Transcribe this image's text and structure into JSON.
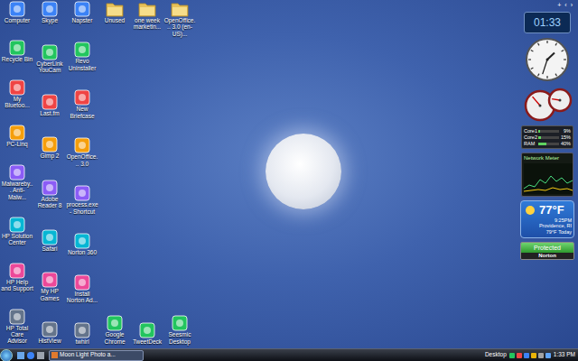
{
  "desktop": {
    "columns": [
      {
        "icons": [
          {
            "label": "Computer",
            "kind": "app"
          },
          {
            "label": "Recycle Bin",
            "kind": "app"
          },
          {
            "label": "My Bluetoo...",
            "kind": "app"
          },
          {
            "label": "PC-Linq",
            "kind": "app"
          },
          {
            "label": "Malwareby... Anti-Malw...",
            "kind": "app"
          },
          {
            "label": "HP Solution Center",
            "kind": "app"
          },
          {
            "label": "HP Help and Support",
            "kind": "app"
          },
          {
            "label": "HP Total Care Advisor",
            "kind": "app"
          }
        ]
      },
      {
        "icons": [
          {
            "label": "Skype",
            "kind": "app"
          },
          {
            "label": "CyberLink YouCam",
            "kind": "app"
          },
          {
            "label": "Last.fm",
            "kind": "app"
          },
          {
            "label": "Gimp 2",
            "kind": "app"
          },
          {
            "label": "Adobe Reader 8",
            "kind": "app"
          },
          {
            "label": "Safari",
            "kind": "app"
          },
          {
            "label": "My HP Games",
            "kind": "app"
          },
          {
            "label": "HistView",
            "kind": "app"
          }
        ]
      },
      {
        "icons": [
          {
            "label": "Napster",
            "kind": "app"
          },
          {
            "label": "Revo Uninstaller",
            "kind": "app"
          },
          {
            "label": "New Briefcase",
            "kind": "app"
          },
          {
            "label": "OpenOffice... 3.0",
            "kind": "app"
          },
          {
            "label": "process.exe - Shortcut",
            "kind": "app"
          },
          {
            "label": "Norton 360",
            "kind": "app"
          },
          {
            "label": "Install Norton Ad...",
            "kind": "app"
          },
          {
            "label": "twhirl",
            "kind": "app"
          }
        ]
      },
      {
        "icons": [
          {
            "label": "Unused",
            "kind": "folder"
          },
          {
            "label": "Google Chrome",
            "kind": "app"
          }
        ]
      },
      {
        "icons": [
          {
            "label": "one week marketin...",
            "kind": "folder"
          },
          {
            "label": "TweetDeck",
            "kind": "app"
          }
        ]
      },
      {
        "icons": [
          {
            "label": "OpenOffice... 3.0 (en-US)...",
            "kind": "folder"
          },
          {
            "label": "Seesmic Desktop",
            "kind": "app"
          }
        ]
      }
    ]
  },
  "sidebar": {
    "controls": [
      "+",
      "‹",
      "›"
    ],
    "digital_clock": "01:33",
    "gauges": [
      {
        "level": 0.35
      },
      {
        "level": 0.2
      }
    ],
    "system_monitor": {
      "rows": [
        {
          "label": "Core1",
          "reading": "9%",
          "level": 0.09
        },
        {
          "label": "Core2",
          "reading": "15%",
          "level": 0.15
        },
        {
          "label": "RAM",
          "reading": "40%",
          "level": 0.4
        }
      ]
    },
    "network_meter": {
      "title": "Network Meter"
    },
    "weather": {
      "temperature": "77°F",
      "time": "9:25PM",
      "location": "Providence, RI",
      "forecast": "79°F",
      "forecast_label": "Today"
    },
    "norton": {
      "status": "Protected",
      "brand": "Norton"
    }
  },
  "taskbar": {
    "tasks": [
      {
        "label": "Moon Light Photo a...",
        "selected": true
      }
    ],
    "toolbar": "Desktop",
    "clock": "1:33 PM"
  }
}
